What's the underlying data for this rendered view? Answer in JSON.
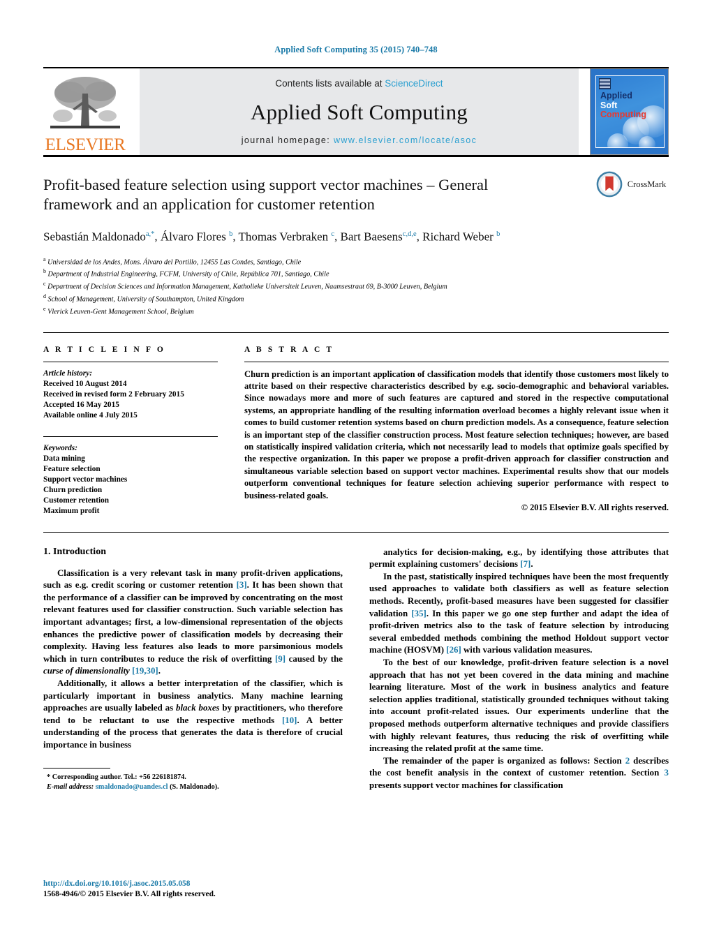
{
  "running_head": "Applied Soft Computing 35 (2015) 740–748",
  "masthead": {
    "publisher_name": "ELSEVIER",
    "contents_prefix": "Contents lists available at",
    "contents_link": "ScienceDirect",
    "journal_title": "Applied Soft Computing",
    "homepage_prefix": "journal homepage:",
    "homepage_url": "www.elsevier.com/locate/asoc",
    "cover": {
      "line1": "Applied",
      "line2": "Soft",
      "line3": "Computing"
    }
  },
  "crossmark": {
    "label": "CrossMark"
  },
  "article": {
    "title": "Profit-based feature selection using support vector machines – General framework and an application for customer retention",
    "authors_html": "Sebastián Maldonado<sup>a,*</sup>, Álvaro Flores <sup>b</sup>, Thomas Verbraken <sup>c</sup>, Bart Baesens<sup>c,d,e</sup>, Richard Weber <sup>b</sup>",
    "affiliations": [
      {
        "marker": "a",
        "text": "Universidad de los Andes, Mons. Álvaro del Portillo, 12455 Las Condes, Santiago, Chile"
      },
      {
        "marker": "b",
        "text": "Department of Industrial Engineering, FCFM, University of Chile, República 701, Santiago, Chile"
      },
      {
        "marker": "c",
        "text": "Department of Decision Sciences and Information Management, Katholieke Universiteit Leuven, Naamsestraat 69, B-3000 Leuven, Belgium"
      },
      {
        "marker": "d",
        "text": "School of Management, University of Southampton, United Kingdom"
      },
      {
        "marker": "e",
        "text": "Vlerick Leuven-Gent Management School, Belgium"
      }
    ]
  },
  "article_info": {
    "heading": "A R T I C L E   I N F O",
    "history_label": "Article history:",
    "history": [
      "Received 10 August 2014",
      "Received in revised form 2 February 2015",
      "Accepted 16 May 2015",
      "Available online 4 July 2015"
    ],
    "keywords_label": "Keywords:",
    "keywords": [
      "Data mining",
      "Feature selection",
      "Support vector machines",
      "Churn prediction",
      "Customer retention",
      "Maximum profit"
    ]
  },
  "abstract": {
    "heading": "A B S T R A C T",
    "text": "Churn prediction is an important application of classification models that identify those customers most likely to attrite based on their respective characteristics described by e.g. socio-demographic and behavioral variables. Since nowadays more and more of such features are captured and stored in the respective computational systems, an appropriate handling of the resulting information overload becomes a highly relevant issue when it comes to build customer retention systems based on churn prediction models. As a consequence, feature selection is an important step of the classifier construction process. Most feature selection techniques; however, are based on statistically inspired validation criteria, which not necessarily lead to models that optimize goals specified by the respective organization. In this paper we propose a profit-driven approach for classifier construction and simultaneous variable selection based on support vector machines. Experimental results show that our models outperform conventional techniques for feature selection achieving superior performance with respect to business-related goals.",
    "copyright": "© 2015 Elsevier B.V. All rights reserved."
  },
  "introduction": {
    "section_number_title": "1.  Introduction",
    "left_paragraphs_html": [
      "Classification is a very relevant task in many profit-driven applications, such as e.g. credit scoring or customer retention <span class=\"ref\">[3]</span>. It has been shown that the performance of a classifier can be improved by concentrating on the most relevant features used for classifier construction. Such variable selection has important advantages; first, a low-dimensional representation of the objects enhances the predictive power of classification models by decreasing their complexity. Having less features also leads to more parsimonious models which in turn contributes to reduce the risk of overfitting <span class=\"ref\">[9]</span> caused by the <span class=\"ital\">curse of dimensionality</span> <span class=\"ref\">[19,30]</span>.",
      "Additionally, it allows a better interpretation of the classifier, which is particularly important in business analytics. Many machine learning approaches are usually labeled as <span class=\"ital\">black boxes</span> by practitioners, who therefore tend to be reluctant to use the respective methods <span class=\"ref\">[10]</span>. A better understanding of the process that generates the data is therefore of crucial importance in business"
    ],
    "right_paragraphs_html": [
      "analytics for decision-making, e.g., by identifying those attributes that permit explaining customers' decisions <span class=\"ref\">[7]</span>.",
      "In the past, statistically inspired techniques have been the most frequently used approaches to validate both classifiers as well as feature selection methods. Recently, profit-based measures have been suggested for classifier validation <span class=\"ref\">[35]</span>. In this paper we go one step further and adapt the idea of profit-driven metrics also to the task of feature selection by introducing several embedded methods combining the method Holdout support vector machine (HOSVM) <span class=\"ref\">[26]</span> with various validation measures.",
      "To the best of our knowledge, profit-driven feature selection is a novel approach that has not yet been covered in the data mining and machine learning literature. Most of the work in business analytics and feature selection applies traditional, statistically grounded techniques without taking into account profit-related issues. Our experiments underline that the proposed methods outperform alternative techniques and provide classifiers with highly relevant features, thus reducing the risk of overfitting while increasing the related profit at the same time.",
      "The remainder of the paper is organized as follows: Section <span class=\"ref\">2</span> describes the cost benefit analysis in the context of customer retention. Section <span class=\"ref\">3</span> presents support vector machines for classification"
    ]
  },
  "footnote": {
    "corresponding_html": "*  Corresponding author. Tel.: +56 226181874.",
    "email_html": "<span class=\"email-label\">E-mail address:</span> <span class=\"email\">smaldonado@uandes.cl</span> (S. Maldonado)."
  },
  "page_footer": {
    "doi": "http://dx.doi.org/10.1016/j.asoc.2015.05.058",
    "issn_line": "1568-4946/© 2015 Elsevier B.V. All rights reserved."
  },
  "colors": {
    "link_teal": "#1a7aa8",
    "sciencedirect_blue": "#2a9fd0",
    "elsevier_orange": "#E87722",
    "cover_blue": "#2f7fd4",
    "crossmark_red": "#d1392f"
  }
}
